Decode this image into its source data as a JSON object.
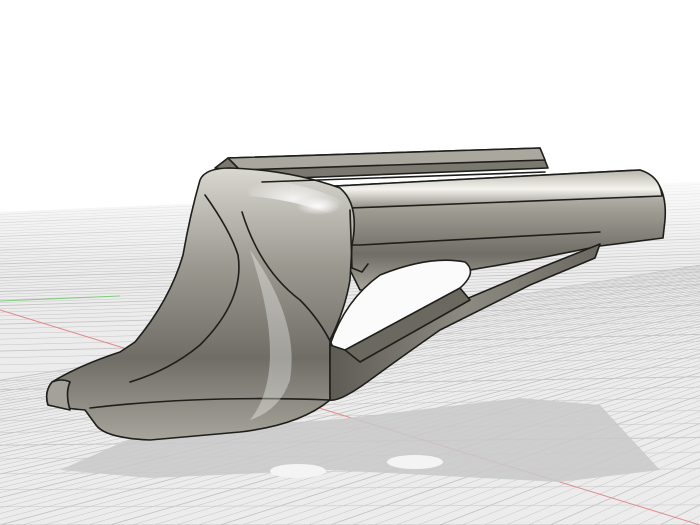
{
  "viewport": {
    "background_color": "#ffffff",
    "ground_grid": "on",
    "grid_line_color": "#c4c4c4",
    "grid_floor_color": "#ececec",
    "x_axis_color": "#e08a8a",
    "z_axis_color": "#7ccc7c"
  },
  "model": {
    "material_color": "#8f8d84",
    "edge_color": "#1e1e1a",
    "shadow_color": "#c9c9c9"
  }
}
